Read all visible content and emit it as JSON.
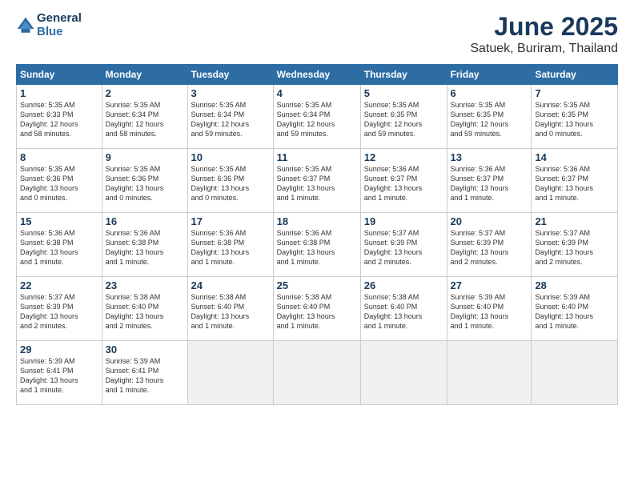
{
  "header": {
    "logo_line1": "General",
    "logo_line2": "Blue",
    "title": "June 2025",
    "subtitle": "Satuek, Buriram, Thailand"
  },
  "calendar": {
    "headers": [
      "Sunday",
      "Monday",
      "Tuesday",
      "Wednesday",
      "Thursday",
      "Friday",
      "Saturday"
    ],
    "rows": [
      [
        {
          "day": "1",
          "info": "Sunrise: 5:35 AM\nSunset: 6:33 PM\nDaylight: 12 hours\nand 58 minutes."
        },
        {
          "day": "2",
          "info": "Sunrise: 5:35 AM\nSunset: 6:34 PM\nDaylight: 12 hours\nand 58 minutes."
        },
        {
          "day": "3",
          "info": "Sunrise: 5:35 AM\nSunset: 6:34 PM\nDaylight: 12 hours\nand 59 minutes."
        },
        {
          "day": "4",
          "info": "Sunrise: 5:35 AM\nSunset: 6:34 PM\nDaylight: 12 hours\nand 59 minutes."
        },
        {
          "day": "5",
          "info": "Sunrise: 5:35 AM\nSunset: 6:35 PM\nDaylight: 12 hours\nand 59 minutes."
        },
        {
          "day": "6",
          "info": "Sunrise: 5:35 AM\nSunset: 6:35 PM\nDaylight: 12 hours\nand 59 minutes."
        },
        {
          "day": "7",
          "info": "Sunrise: 5:35 AM\nSunset: 6:35 PM\nDaylight: 13 hours\nand 0 minutes."
        }
      ],
      [
        {
          "day": "8",
          "info": "Sunrise: 5:35 AM\nSunset: 6:36 PM\nDaylight: 13 hours\nand 0 minutes."
        },
        {
          "day": "9",
          "info": "Sunrise: 5:35 AM\nSunset: 6:36 PM\nDaylight: 13 hours\nand 0 minutes."
        },
        {
          "day": "10",
          "info": "Sunrise: 5:35 AM\nSunset: 6:36 PM\nDaylight: 13 hours\nand 0 minutes."
        },
        {
          "day": "11",
          "info": "Sunrise: 5:35 AM\nSunset: 6:37 PM\nDaylight: 13 hours\nand 1 minute."
        },
        {
          "day": "12",
          "info": "Sunrise: 5:36 AM\nSunset: 6:37 PM\nDaylight: 13 hours\nand 1 minute."
        },
        {
          "day": "13",
          "info": "Sunrise: 5:36 AM\nSunset: 6:37 PM\nDaylight: 13 hours\nand 1 minute."
        },
        {
          "day": "14",
          "info": "Sunrise: 5:36 AM\nSunset: 6:37 PM\nDaylight: 13 hours\nand 1 minute."
        }
      ],
      [
        {
          "day": "15",
          "info": "Sunrise: 5:36 AM\nSunset: 6:38 PM\nDaylight: 13 hours\nand 1 minute."
        },
        {
          "day": "16",
          "info": "Sunrise: 5:36 AM\nSunset: 6:38 PM\nDaylight: 13 hours\nand 1 minute."
        },
        {
          "day": "17",
          "info": "Sunrise: 5:36 AM\nSunset: 6:38 PM\nDaylight: 13 hours\nand 1 minute."
        },
        {
          "day": "18",
          "info": "Sunrise: 5:36 AM\nSunset: 6:38 PM\nDaylight: 13 hours\nand 1 minute."
        },
        {
          "day": "19",
          "info": "Sunrise: 5:37 AM\nSunset: 6:39 PM\nDaylight: 13 hours\nand 2 minutes."
        },
        {
          "day": "20",
          "info": "Sunrise: 5:37 AM\nSunset: 6:39 PM\nDaylight: 13 hours\nand 2 minutes."
        },
        {
          "day": "21",
          "info": "Sunrise: 5:37 AM\nSunset: 6:39 PM\nDaylight: 13 hours\nand 2 minutes."
        }
      ],
      [
        {
          "day": "22",
          "info": "Sunrise: 5:37 AM\nSunset: 6:39 PM\nDaylight: 13 hours\nand 2 minutes."
        },
        {
          "day": "23",
          "info": "Sunrise: 5:38 AM\nSunset: 6:40 PM\nDaylight: 13 hours\nand 2 minutes."
        },
        {
          "day": "24",
          "info": "Sunrise: 5:38 AM\nSunset: 6:40 PM\nDaylight: 13 hours\nand 1 minute."
        },
        {
          "day": "25",
          "info": "Sunrise: 5:38 AM\nSunset: 6:40 PM\nDaylight: 13 hours\nand 1 minute."
        },
        {
          "day": "26",
          "info": "Sunrise: 5:38 AM\nSunset: 6:40 PM\nDaylight: 13 hours\nand 1 minute."
        },
        {
          "day": "27",
          "info": "Sunrise: 5:39 AM\nSunset: 6:40 PM\nDaylight: 13 hours\nand 1 minute."
        },
        {
          "day": "28",
          "info": "Sunrise: 5:39 AM\nSunset: 6:40 PM\nDaylight: 13 hours\nand 1 minute."
        }
      ],
      [
        {
          "day": "29",
          "info": "Sunrise: 5:39 AM\nSunset: 6:41 PM\nDaylight: 13 hours\nand 1 minute."
        },
        {
          "day": "30",
          "info": "Sunrise: 5:39 AM\nSunset: 6:41 PM\nDaylight: 13 hours\nand 1 minute."
        },
        {
          "day": "",
          "info": ""
        },
        {
          "day": "",
          "info": ""
        },
        {
          "day": "",
          "info": ""
        },
        {
          "day": "",
          "info": ""
        },
        {
          "day": "",
          "info": ""
        }
      ]
    ]
  }
}
